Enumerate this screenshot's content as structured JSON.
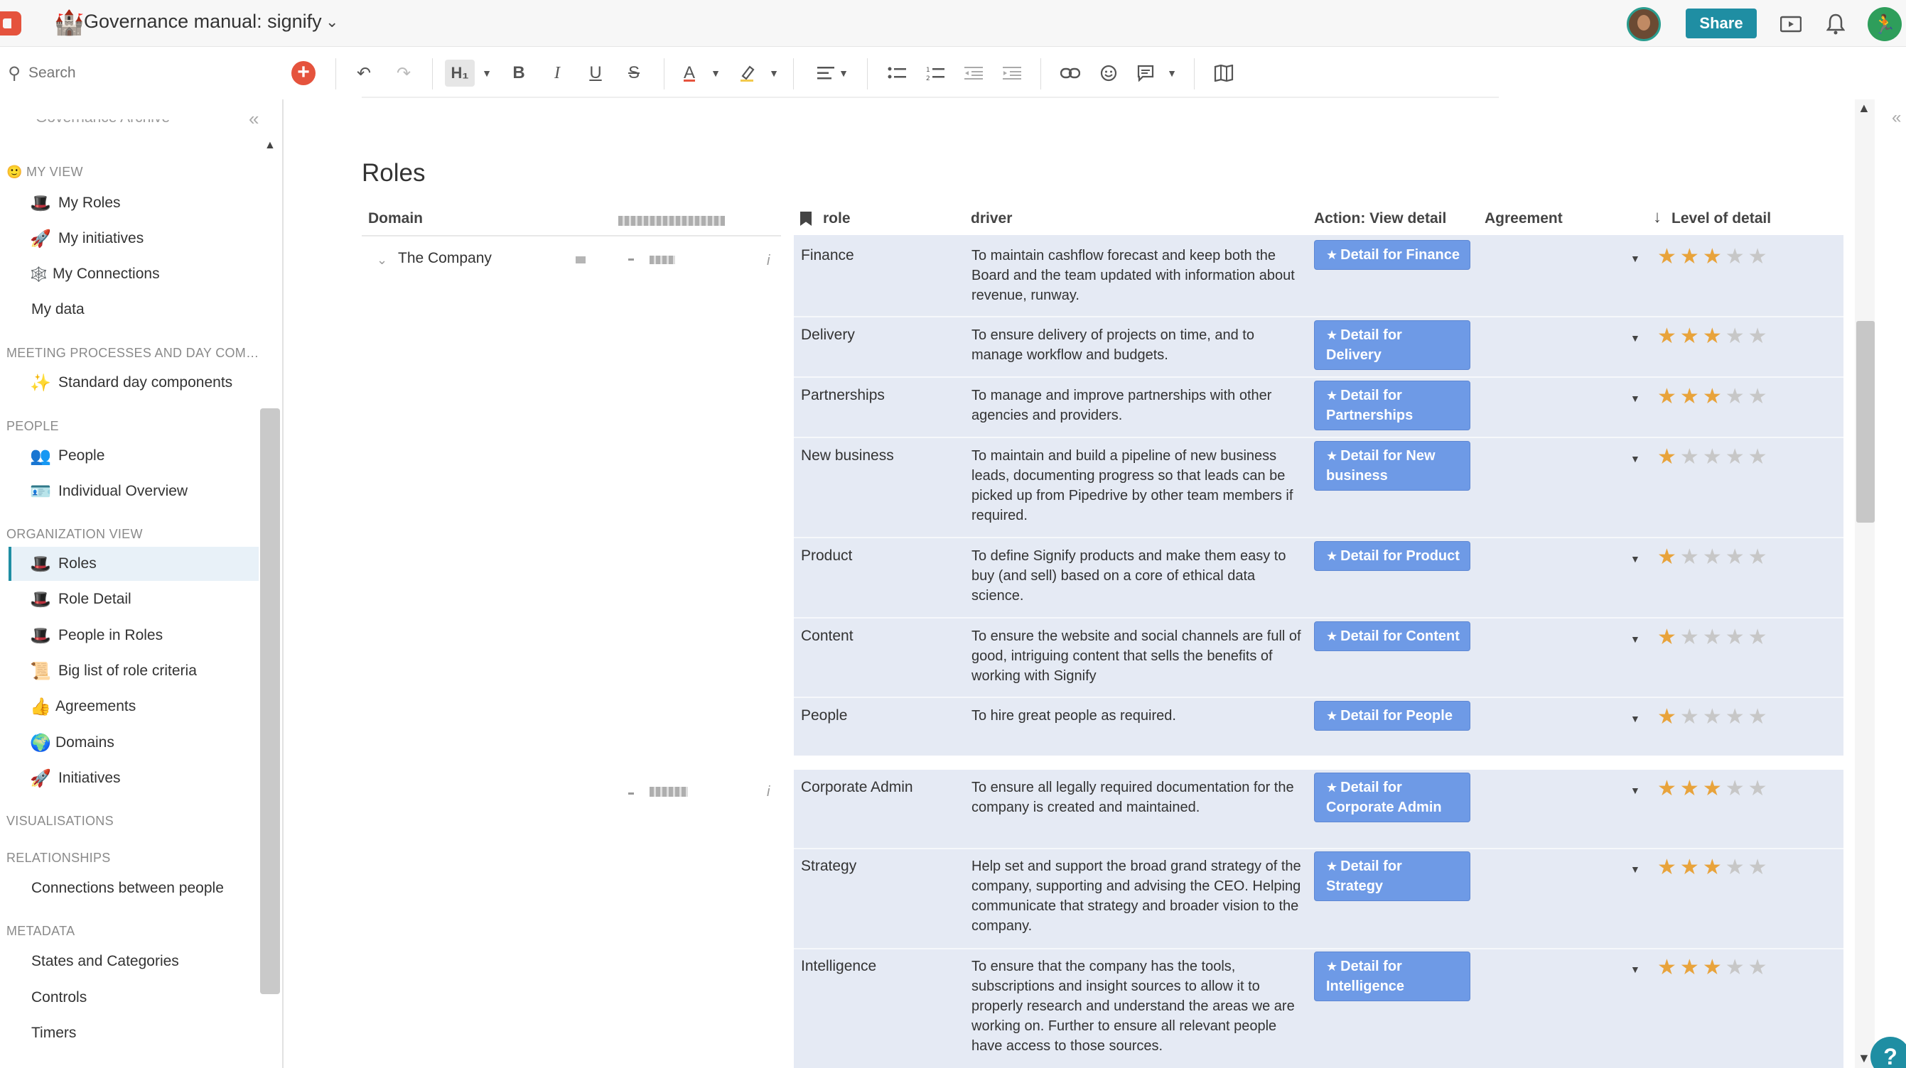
{
  "app": {
    "doc_emoji": "🏰",
    "doc_title": "Governance manual: signify",
    "share_label": "Share"
  },
  "toolbar": {
    "search_placeholder": "Search",
    "heading_label": "H₁",
    "bold": "B",
    "italic": "I",
    "underline": "U",
    "strike": "S",
    "text_color": "A"
  },
  "sidebar": {
    "cut_item": "Governance Archive",
    "sections": {
      "my_view": "MY VIEW",
      "meeting": "MEETING PROCESSES AND DAY COM…",
      "people": "PEOPLE",
      "org_view": "ORGANIZATION VIEW",
      "visualisations": "VISUALISATIONS",
      "relationships": "RELATIONSHIPS",
      "metadata": "METADATA"
    },
    "items": [
      {
        "icon": "🎩",
        "label": "My Roles"
      },
      {
        "icon": "🚀",
        "label": "My initiatives"
      },
      {
        "icon": "🕸️",
        "label": "My Connections"
      },
      {
        "icon": "",
        "label": "My  data"
      },
      {
        "icon": "✨",
        "label": "Standard day components"
      },
      {
        "icon": "👥",
        "label": "People"
      },
      {
        "icon": "🪪",
        "label": "Individual Overview"
      },
      {
        "icon": "🎩",
        "label": "Roles"
      },
      {
        "icon": "🎩",
        "label": "Role Detail"
      },
      {
        "icon": "🎩",
        "label": "People in Roles"
      },
      {
        "icon": "📜",
        "label": "Big list of role criteria"
      },
      {
        "icon": "👍",
        "label": "Agreements"
      },
      {
        "icon": "🌍",
        "label": "Domains"
      },
      {
        "icon": "🚀",
        "label": "Initiatives"
      },
      {
        "icon": "",
        "label": "Connections between people"
      },
      {
        "icon": "",
        "label": "States and Categories"
      },
      {
        "icon": "",
        "label": "Controls"
      },
      {
        "icon": "",
        "label": "Timers"
      }
    ]
  },
  "main": {
    "page_title": "Roles",
    "columns": {
      "domain": "Domain",
      "role": "role",
      "driver": "driver",
      "action": "Action: View detail",
      "agreement": "Agreement",
      "level": "Level of detail"
    },
    "tree_label": "The Company",
    "rows": [
      {
        "role": "Finance",
        "driver": "To maintain cashflow forecast and keep both the Board and the team updated with information about revenue, runway.",
        "button": "Detail for Finance",
        "level": 3
      },
      {
        "role": "Delivery",
        "driver": "To ensure delivery of projects on time, and to manage workflow and budgets.",
        "button": "Detail for Delivery",
        "level": 3
      },
      {
        "role": "Partnerships",
        "driver": "To manage and improve partnerships with other agencies and providers.",
        "button": "Detail for Partnerships",
        "level": 3
      },
      {
        "role": "New business",
        "driver": "To maintain and build a pipeline of new business leads, documenting progress so that leads can be picked up from Pipedrive by other team members if required.",
        "button": "Detail for New business",
        "level": 1
      },
      {
        "role": "Product",
        "driver": "To define Signify products and make them easy to buy (and sell) based on a core of ethical data science.",
        "button": "Detail for Product",
        "level": 1
      },
      {
        "role": "Content",
        "driver": "To ensure the website and social channels are full of good, intriguing content that sells the benefits of working with Signify",
        "button": "Detail for Content",
        "level": 1
      },
      {
        "role": "People",
        "driver": "To hire great people as required.",
        "button": "Detail for People",
        "level": 1
      },
      {
        "role": "Corporate Admin",
        "driver": "To ensure all legally required documentation for the company is created and maintained.",
        "button": "Detail for Corporate Admin",
        "level": 3
      },
      {
        "role": "Strategy",
        "driver": "Help set and support the broad grand strategy of the company, supporting and advising the CEO. Helping communicate that strategy and broader vision to the company.",
        "button": "Detail for Strategy",
        "level": 3
      },
      {
        "role": "Intelligence",
        "driver": "To ensure that the company has the tools, subscriptions and insight sources to allow it to properly research and understand the areas we are working on. Further to ensure all relevant people have access to those sources.",
        "button": "Detail for Intelligence",
        "level": 3
      }
    ]
  },
  "colors": {
    "accent": "#1f8ea3",
    "brand_red": "#e5533d",
    "button_blue": "#6e9ae6",
    "table_bg": "#e5eaf4",
    "star_on": "#e8a33b",
    "star_off": "#c7c7c7"
  }
}
